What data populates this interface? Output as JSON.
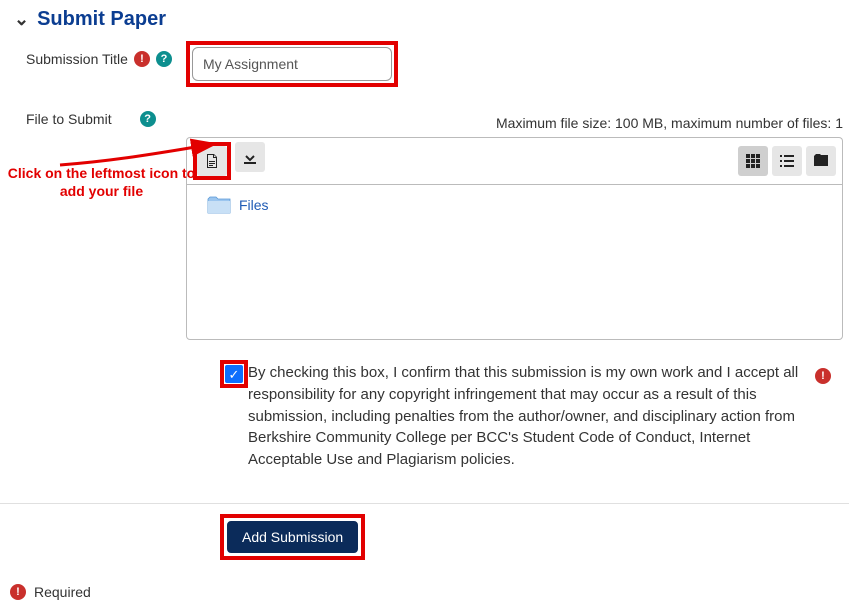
{
  "section": {
    "title": "Submit Paper"
  },
  "title_field": {
    "label": "Submission Title",
    "value": "My Assignment"
  },
  "file_field": {
    "label": "File to Submit",
    "constraint": "Maximum file size: 100 MB, maximum number of files: 1",
    "folder_label": "Files"
  },
  "toolbar_icons": {
    "add": "add-file-icon",
    "download": "download-icon",
    "view_grid": "grid-view-icon",
    "view_list": "list-view-icon",
    "view_tree": "tree-view-icon"
  },
  "agreement": {
    "text": "By checking this box, I confirm that this submission is my own work and I accept all responsibility for any copyright infringement that may occur as a result of this submission, including penalties from the author/owner, and disciplinary action from Berkshire Community College per BCC's Student Code of Conduct, Internet Acceptable Use and Plagiarism policies.",
    "checked": true
  },
  "submit": {
    "label": "Add Submission"
  },
  "footer": {
    "required_label": "Required"
  },
  "annotation": {
    "text": "Click on the leftmost icon to add your file"
  }
}
